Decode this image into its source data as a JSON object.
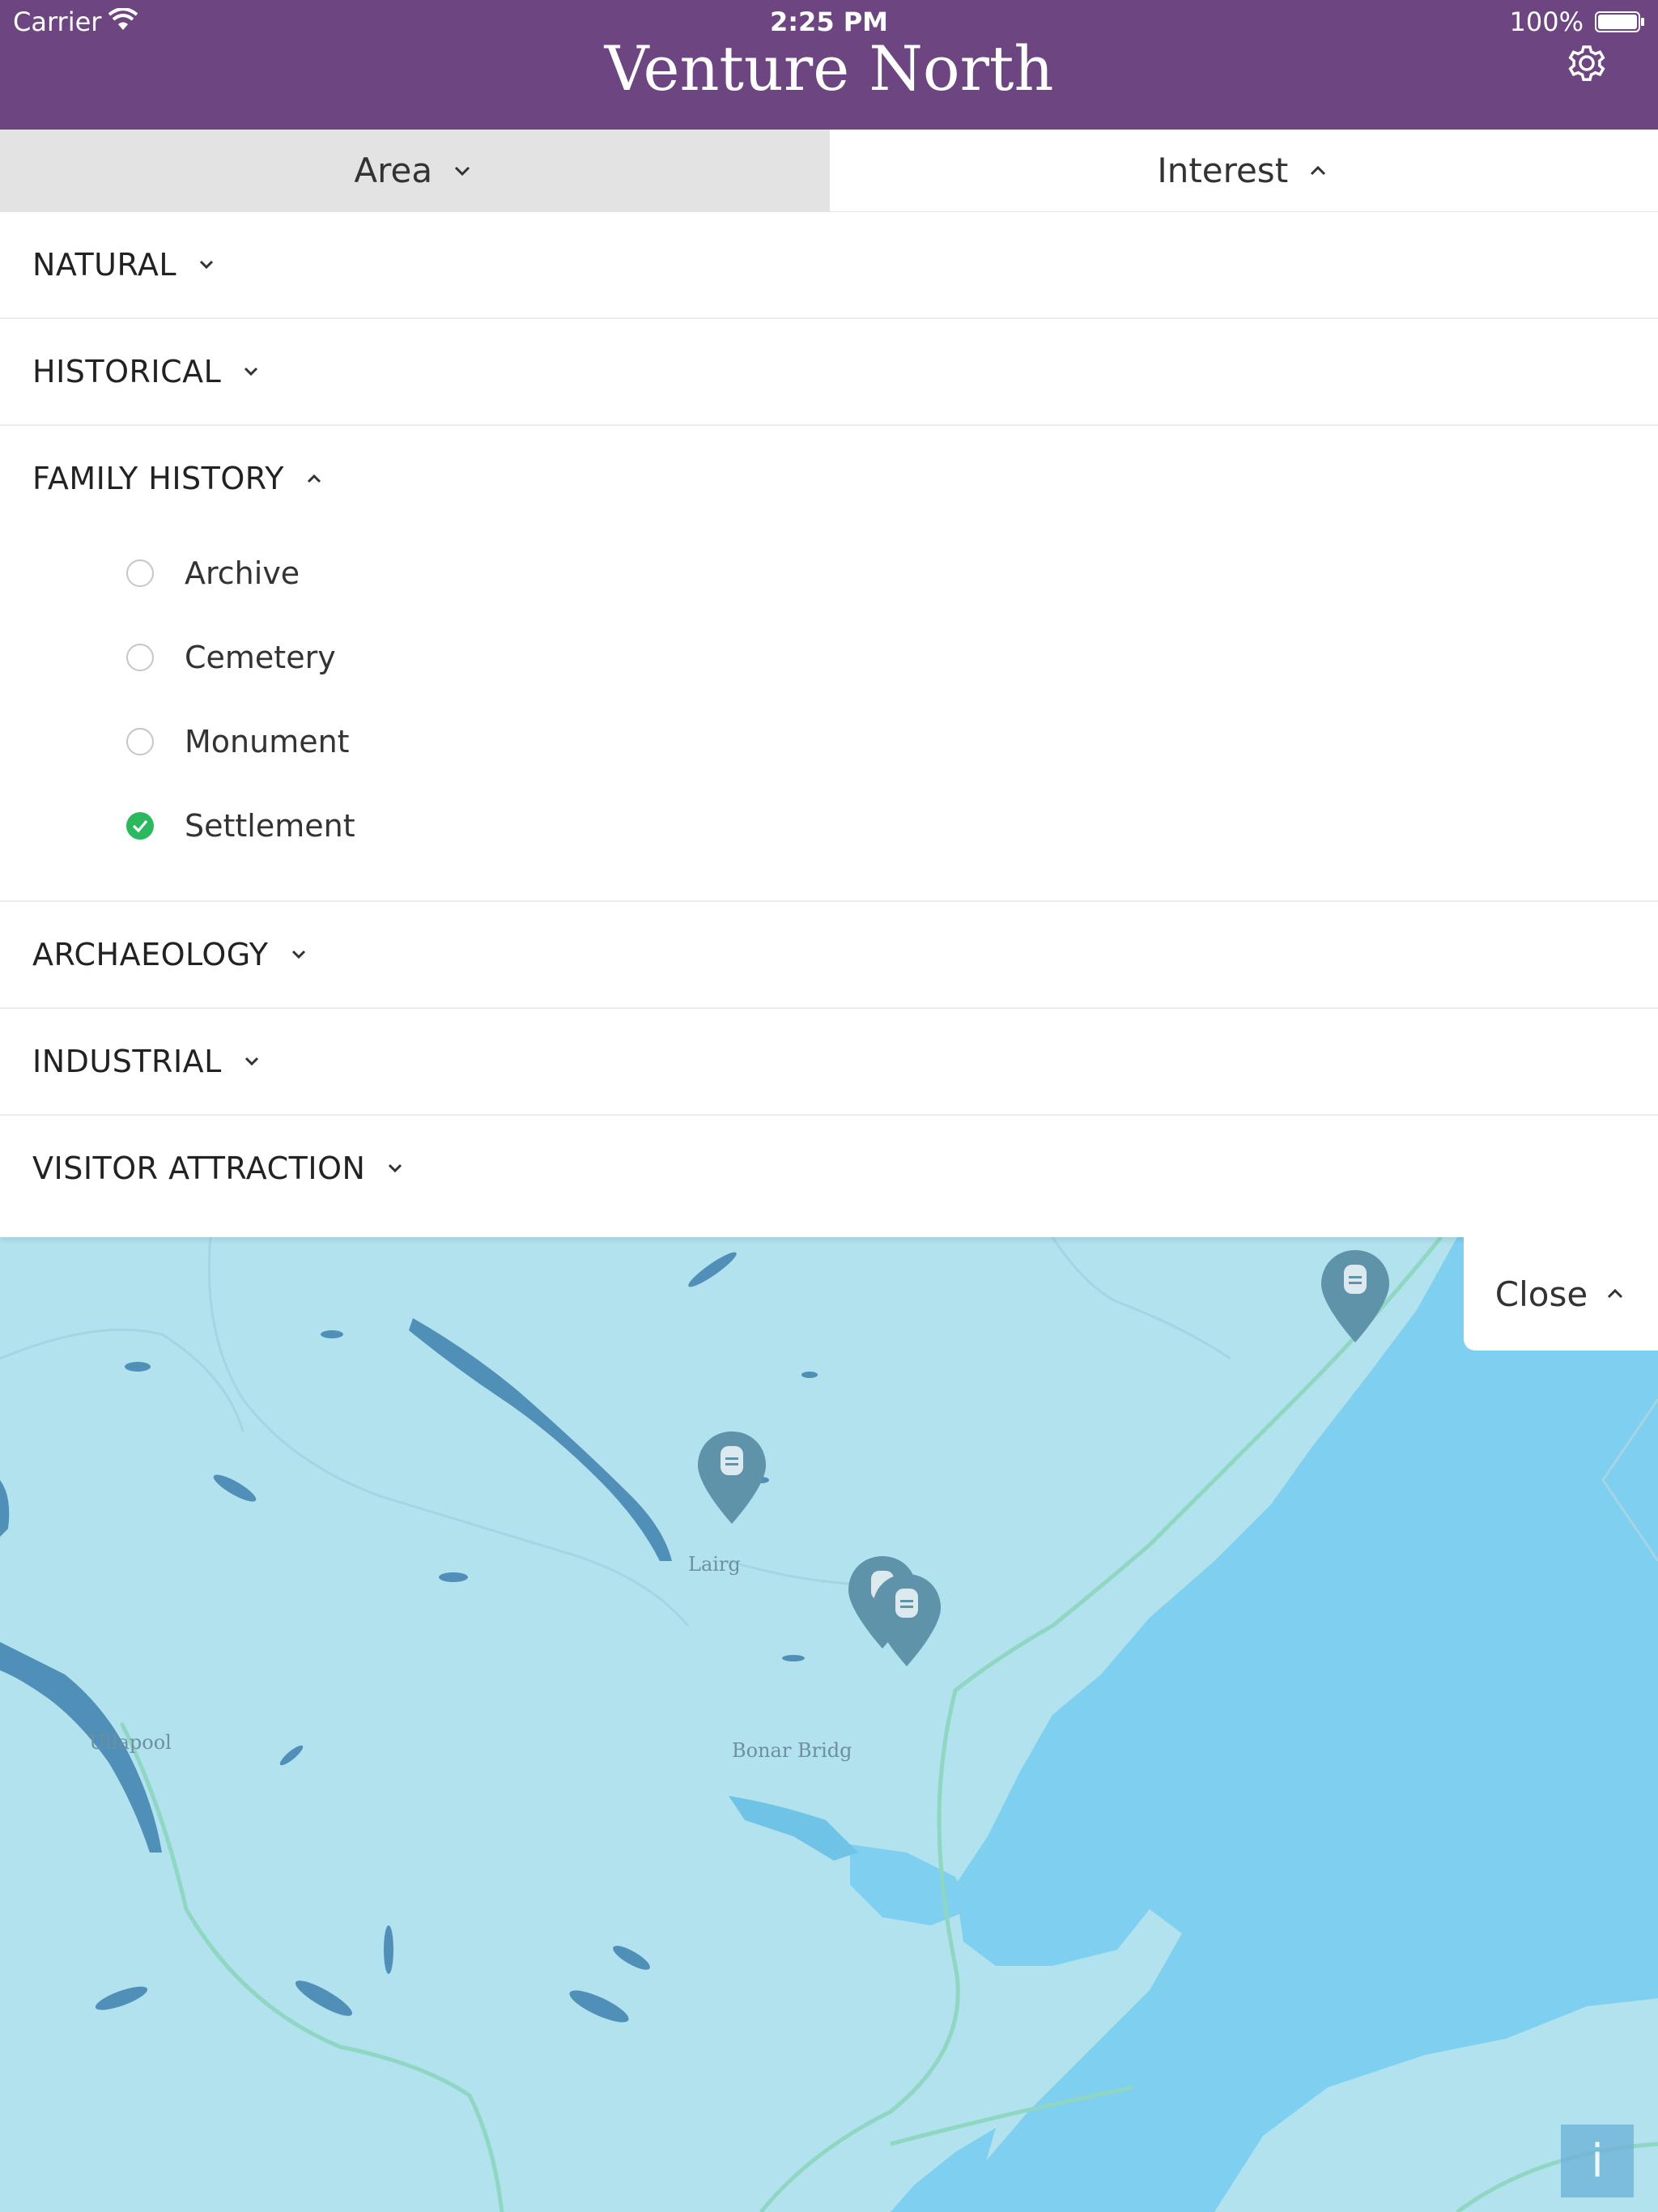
{
  "status_bar": {
    "carrier": "Carrier",
    "time": "2:25 PM",
    "battery": "100%"
  },
  "header": {
    "title": "Venture North",
    "settings_icon": "gear-icon"
  },
  "tabs": [
    {
      "label": "Area",
      "expanded": false
    },
    {
      "label": "Interest",
      "expanded": true
    }
  ],
  "categories": [
    {
      "label": "NATURAL",
      "expanded": false
    },
    {
      "label": "HISTORICAL",
      "expanded": false
    },
    {
      "label": "FAMILY HISTORY",
      "expanded": true,
      "items": [
        {
          "label": "Archive",
          "checked": false
        },
        {
          "label": "Cemetery",
          "checked": false
        },
        {
          "label": "Monument",
          "checked": false
        },
        {
          "label": "Settlement",
          "checked": true
        }
      ]
    },
    {
      "label": "ARCHAEOLOGY",
      "expanded": false
    },
    {
      "label": "INDUSTRIAL",
      "expanded": false
    },
    {
      "label": "VISITOR ATTRACTION",
      "expanded": false
    }
  ],
  "close_button": {
    "label": "Close"
  },
  "map": {
    "places": [
      "Lairg",
      "Ullapool",
      "Bonar Bridg"
    ],
    "info_button": "i",
    "colors": {
      "land": "#b1e2ee",
      "sea": "#7fcff0",
      "water": "#4f8fb8",
      "road": "#8fd6c3",
      "pin": "#5f93aa"
    }
  }
}
